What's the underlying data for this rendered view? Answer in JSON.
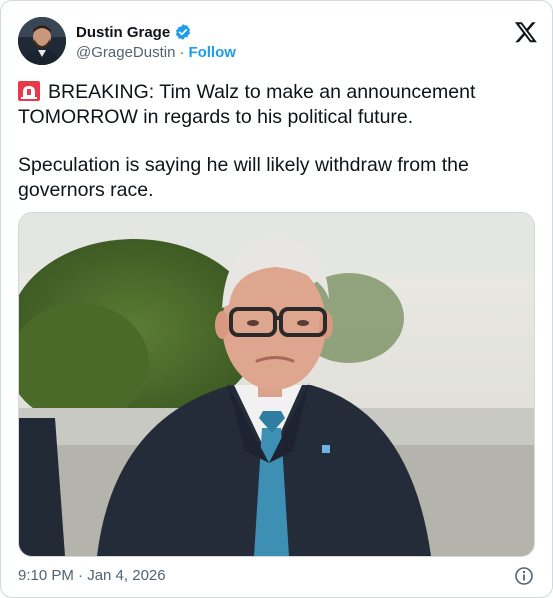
{
  "author": {
    "display_name": "Dustin Grage",
    "handle": "@GrageDustin",
    "separator": "·",
    "follow_label": "Follow",
    "verified": true
  },
  "tweet": {
    "line1": "BREAKING: Tim Walz to make an announcement TOMORROW in regards to his political future.",
    "line2": "Speculation is saying he will likely withdraw from the governors race."
  },
  "footer": {
    "timestamp": "9:10 PM · Jan 4, 2026"
  },
  "icons": {
    "verified": "verified-badge-icon",
    "platform": "x-logo-icon",
    "siren": "rotating-light-icon",
    "info": "info-icon"
  },
  "colors": {
    "accent": "#1d9bf0",
    "text": "#0f1419",
    "secondary": "#536471",
    "border": "#cfd9de"
  }
}
